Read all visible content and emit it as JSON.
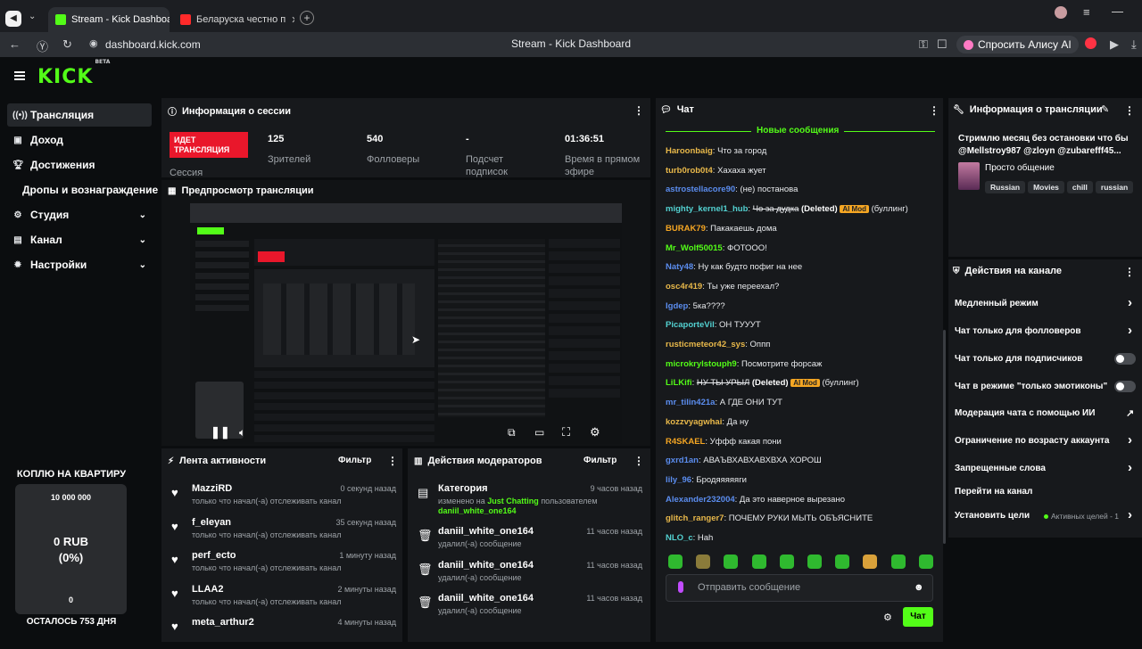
{
  "browser": {
    "tabs": [
      {
        "label": "Stream - Kick Dashboard",
        "active": true
      },
      {
        "label": "Беларуска честно п",
        "active": false
      }
    ],
    "url": "dashboard.kick.com",
    "page_title": "Stream - Kick Dashboard",
    "alice_label": "Спросить Алису AI"
  },
  "app": {
    "logo": "KICK",
    "logo_beta": "BETA",
    "accent": "#53fc18"
  },
  "sidebar": {
    "items": [
      {
        "label": "Трансляция",
        "icon": "broadcast-icon",
        "selected": true
      },
      {
        "label": "Доход",
        "icon": "revenue-icon"
      },
      {
        "label": "Достижения",
        "icon": "trophy-icon"
      },
      {
        "label": "Дропы и вознаграждение"
      },
      {
        "label": "Студия",
        "icon": "studio-icon",
        "expandable": true
      },
      {
        "label": "Канал",
        "icon": "channel-icon",
        "expandable": true
      },
      {
        "label": "Настройки",
        "icon": "gear-icon",
        "expandable": true
      }
    ]
  },
  "overlay": {
    "title": "КОПЛЮ НА КВАРТИРУ",
    "goal": "10 000 000",
    "amount": "0 RUB",
    "percent": "(0%)",
    "progress": 0,
    "zero": "0",
    "remaining": "ОСТАЛОСЬ 753 ДНЯ"
  },
  "session": {
    "title": "Информация о сессии",
    "live_badge": "ИДЕТ ТРАНСЛЯЦИЯ",
    "live_sub": "Сессия",
    "stats": [
      {
        "value": "125",
        "label": "Зрителей"
      },
      {
        "value": "540",
        "label": "Фолловеры"
      },
      {
        "value": "-",
        "label": "Подсчет подписок"
      },
      {
        "value": "01:36:51",
        "label": "Время в прямом эфире"
      }
    ]
  },
  "preview": {
    "title": "Предпросмотр трансляции"
  },
  "activity": {
    "title": "Лента активности",
    "filter": "Фильтр",
    "items": [
      {
        "name": "MazziRD",
        "sub": "только что начал(-а) отслеживать канал",
        "time": "0 секунд назад"
      },
      {
        "name": "f_eleyan",
        "sub": "только что начал(-а) отслеживать канал",
        "time": "35 секунд назад"
      },
      {
        "name": "perf_ecto",
        "sub": "только что начал(-а) отслеживать канал",
        "time": "1 минуту назад"
      },
      {
        "name": "LLAA2",
        "sub": "только что начал(-а) отслеживать канал",
        "time": "2 минуты назад"
      },
      {
        "name": "meta_arthur2",
        "sub": "",
        "time": "4 минуты назад"
      }
    ]
  },
  "mod_actions": {
    "title": "Действия модераторов",
    "filter": "Фильтр",
    "items": [
      {
        "name": "Категория",
        "sub_pre": "изменено на",
        "sub_hl": "Just Chatting",
        "sub_post": "пользователем",
        "sub2": "daniil_white_one164",
        "time": "9 часов назад"
      },
      {
        "name": "daniil_white_one164",
        "sub": "удалил(-а) сообщение",
        "time": "11 часов назад"
      },
      {
        "name": "daniil_white_one164",
        "sub": "удалил(-а) сообщение",
        "time": "11 часов назад"
      },
      {
        "name": "daniil_white_one164",
        "sub": "удалил(-а) сообщение",
        "time": "11 часов назад"
      }
    ]
  },
  "chat": {
    "title": "Чат",
    "new_messages": "Новые сообщения",
    "placeholder": "Отправить сообщение",
    "send": "Чат",
    "messages": [
      {
        "user": "Haroonbaig",
        "color": "#e8b84a",
        "text": "Что за город"
      },
      {
        "user": "turb0rob0t4",
        "color": "#e8b84a",
        "text": "Хахаха жует"
      },
      {
        "user": "astrostellacore90",
        "color": "#5b8def",
        "text": "(не) постанова"
      },
      {
        "user": "mighty_kernel1_hub",
        "color": "#53d1d1",
        "strike": "Чо за дудка",
        "deleted": "(Deleted)",
        "badge": "AI Mod",
        "text": "(буллинг)"
      },
      {
        "user": "BURAK79",
        "color": "#f5a623",
        "text": "Пакакаешь дома"
      },
      {
        "user": "Mr_Wolf50015",
        "color": "#53fc18",
        "text": "ФОТООО!"
      },
      {
        "user": "Naty48",
        "color": "#5b8def",
        "text": "Ну как будто пофиг на нее"
      },
      {
        "user": "osc4r419",
        "color": "#e8b84a",
        "text": "Ты уже переехал?"
      },
      {
        "user": "Igdep",
        "color": "#5b8def",
        "text": "5ка????"
      },
      {
        "user": "PicaporteVil",
        "color": "#53d1d1",
        "text": "ОН ТУУУТ"
      },
      {
        "user": "rusticmeteor42_sys",
        "color": "#e8b84a",
        "text": "Оппп"
      },
      {
        "user": "microkrylstouph9",
        "color": "#53fc18",
        "text": "Посмотрите форсаж"
      },
      {
        "user": "LiLKifi",
        "color": "#53fc18",
        "strike": "НУ ТЫ УРЫЛ",
        "deleted": "(Deleted)",
        "badge": "AI Mod",
        "text": "(буллинг)"
      },
      {
        "user": "mr_tilin421a",
        "color": "#5b8def",
        "text": "А ГДЕ ОНИ ТУТ"
      },
      {
        "user": "kozzvyagwhai",
        "color": "#e8b84a",
        "text": "Да ну"
      },
      {
        "user": "R4SKAEL",
        "color": "#f5a623",
        "text": "Уффф какая пони"
      },
      {
        "user": "gxrd1an",
        "color": "#5b8def",
        "text": "АВАЪВХАВХАВХВХА ХОРОШ"
      },
      {
        "user": "lily_96",
        "color": "#5b8def",
        "text": "Бродяяяяяги"
      },
      {
        "user": "Alexander232004",
        "color": "#5b8def",
        "text": "Да это наверное вырезано"
      },
      {
        "user": "glitch_ranger7",
        "color": "#e8b84a",
        "text": "ПОЧЕМУ РУКИ МЫТЬ ОБЪЯСНИТЕ"
      },
      {
        "user": "NLO_c",
        "color": "#53d1d1",
        "text": "Hah"
      }
    ]
  },
  "stream_info": {
    "title": "Информация о трансляции",
    "stream_title": "Стримлю месяц без остановки что бы @Mellstroy987 @zloyn @zubarefff45...",
    "category": "Просто общение",
    "tags": [
      "Russian",
      "Movies",
      "chill",
      "russian"
    ]
  },
  "channel_actions": {
    "title": "Действия на канале",
    "items": [
      {
        "label": "Медленный режим",
        "control": "chevron"
      },
      {
        "label": "Чат только для фолловеров",
        "control": "chevron"
      },
      {
        "label": "Чат только для подписчиков",
        "control": "toggle"
      },
      {
        "label": "Чат в режиме \"только эмотиконы\"",
        "control": "toggle"
      },
      {
        "label": "Модерация чата с помощью ИИ",
        "control": "external"
      },
      {
        "label": "Ограничение по возрасту аккаунта",
        "control": "chevron"
      },
      {
        "label": "Запрещенные слова",
        "control": "chevron"
      },
      {
        "label": "Перейти на канал",
        "control": "none"
      },
      {
        "label": "Установить цели",
        "control": "chevron",
        "extra": "Активных целей - 1"
      }
    ]
  }
}
